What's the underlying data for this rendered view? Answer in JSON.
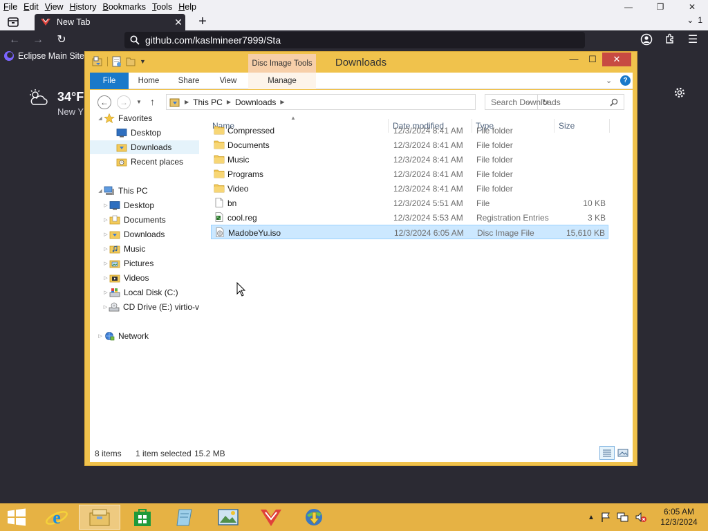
{
  "browser": {
    "menu": [
      {
        "label": "File",
        "u": "F",
        "rest": "ile"
      },
      {
        "label": "Edit",
        "u": "E",
        "rest": "dit"
      },
      {
        "label": "View",
        "u": "V",
        "rest": "iew"
      },
      {
        "label": "History",
        "u": "H",
        "rest": "istory"
      },
      {
        "label": "Bookmarks",
        "u": "B",
        "rest": "ookmarks"
      },
      {
        "label": "Tools",
        "u": "T",
        "rest": "ools"
      },
      {
        "label": "Help",
        "u": "H",
        "rest": "elp"
      }
    ],
    "tab_title": "New Tab",
    "tabs_overflow_count": "1",
    "url": "github.com/kaslmineer7999/Sta",
    "bookmark": "Eclipse Main Site",
    "weather_temp": "34°F",
    "weather_location": "New Y"
  },
  "explorer": {
    "title": "Downloads",
    "contextual_group": "Disc Image Tools",
    "ribbon_tabs": [
      "File",
      "Home",
      "Share",
      "View",
      "Manage"
    ],
    "address": [
      "This PC",
      "Downloads"
    ],
    "search_placeholder": "Search Downloads",
    "nav": {
      "favorites_label": "Favorites",
      "favorites": [
        "Desktop",
        "Downloads",
        "Recent places"
      ],
      "thispc_label": "This PC",
      "thispc": [
        "Desktop",
        "Documents",
        "Downloads",
        "Music",
        "Pictures",
        "Videos",
        "Local Disk (C:)",
        "CD Drive (E:) virtio-v"
      ],
      "network_label": "Network"
    },
    "columns": [
      "Name",
      "Date modified",
      "Type",
      "Size"
    ],
    "files": [
      {
        "name": "Compressed",
        "date": "12/3/2024 8:41 AM",
        "type": "File folder",
        "size": "",
        "icon": "folder-icon"
      },
      {
        "name": "Documents",
        "date": "12/3/2024 8:41 AM",
        "type": "File folder",
        "size": "",
        "icon": "folder-icon"
      },
      {
        "name": "Music",
        "date": "12/3/2024 8:41 AM",
        "type": "File folder",
        "size": "",
        "icon": "folder-icon"
      },
      {
        "name": "Programs",
        "date": "12/3/2024 8:41 AM",
        "type": "File folder",
        "size": "",
        "icon": "folder-icon"
      },
      {
        "name": "Video",
        "date": "12/3/2024 8:41 AM",
        "type": "File folder",
        "size": "",
        "icon": "folder-icon"
      },
      {
        "name": "bn",
        "date": "12/3/2024 5:51 AM",
        "type": "File",
        "size": "10 KB",
        "icon": "file-icon"
      },
      {
        "name": "cool.reg",
        "date": "12/3/2024 5:53 AM",
        "type": "Registration Entries",
        "size": "3 KB",
        "icon": "registry-file-icon"
      },
      {
        "name": "MadobeYu.iso",
        "date": "12/3/2024 6:05 AM",
        "type": "Disc Image File",
        "size": "15,610 KB",
        "icon": "disc-image-icon"
      }
    ],
    "status_count": "8 items",
    "status_selected": "1 item selected",
    "status_size": "15.2 MB"
  },
  "taskbar": {
    "time": "6:05 AM",
    "date": "12/3/2024"
  },
  "colors": {
    "accent": "#1979ca",
    "window_frame": "#f0c24c",
    "taskbar": "#e6b244",
    "close_button": "#c74a42",
    "selection": "#cce8ff"
  }
}
